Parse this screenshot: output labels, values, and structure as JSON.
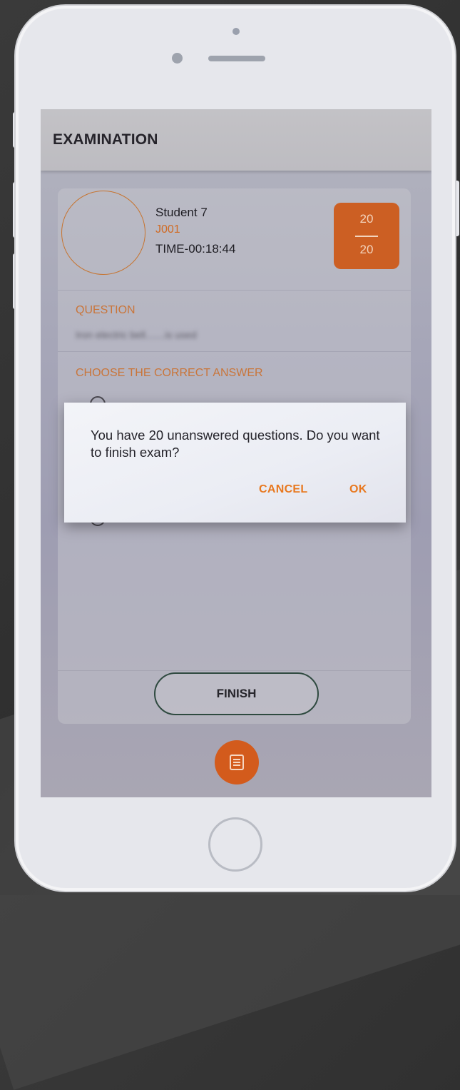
{
  "app": {
    "title": "EXAMINATION"
  },
  "student": {
    "name": "Student 7",
    "id": "J001",
    "time": "TIME-00:18:44"
  },
  "counter": {
    "top": "20",
    "bottom": "20"
  },
  "question": {
    "label": "QUESTION",
    "text": "Iron electric bell.......is used"
  },
  "answers": {
    "label": "CHOOSE THE CORRECT ANSWER"
  },
  "finish": {
    "label": "FINISH"
  },
  "dialog": {
    "message": "You have 20 unanswered questions. Do you want to finish exam?",
    "cancel_label": "CANCEL",
    "ok_label": "OK"
  },
  "colors": {
    "accent": "#d35b1c",
    "dialog_button": "#e8781f",
    "section_label": "#c9753a"
  },
  "icons": {
    "fab": "list-icon"
  }
}
